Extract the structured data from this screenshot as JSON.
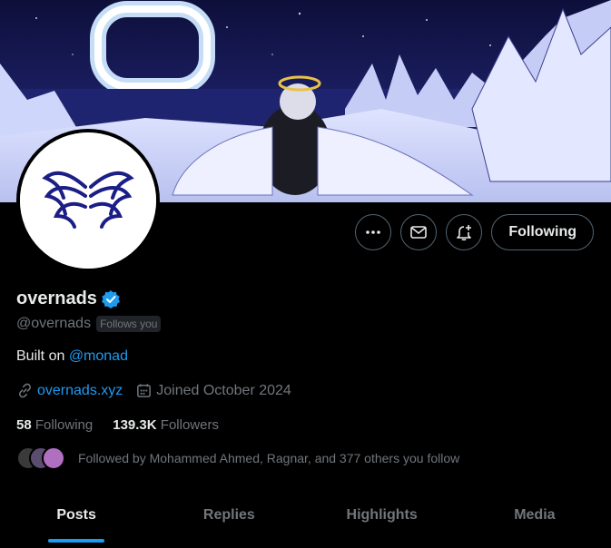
{
  "profile": {
    "name": "overnads",
    "handle": "@overnads",
    "follows_you": "Follows you",
    "bio_prefix": "Built on ",
    "bio_mention": "@monad",
    "website": "overnads.xyz",
    "joined": "Joined October 2024",
    "following_count": "58",
    "following_label": "Following",
    "followers_count": "139.3K",
    "followers_label": "Followers",
    "followed_by": "Followed by Mohammed Ahmed, Ragnar, and 377 others you follow"
  },
  "actions": {
    "more_icon": "more-icon",
    "message_icon": "envelope-icon",
    "notify_icon": "bell-plus-icon",
    "follow_label": "Following"
  },
  "tabs": [
    {
      "label": "Posts",
      "active": true
    },
    {
      "label": "Replies",
      "active": false
    },
    {
      "label": "Highlights",
      "active": false
    },
    {
      "label": "Media",
      "active": false
    }
  ],
  "colors": {
    "accent": "#1d9bf0",
    "background": "#000000",
    "text_primary": "#e7e9ea",
    "text_secondary": "#71767b"
  }
}
